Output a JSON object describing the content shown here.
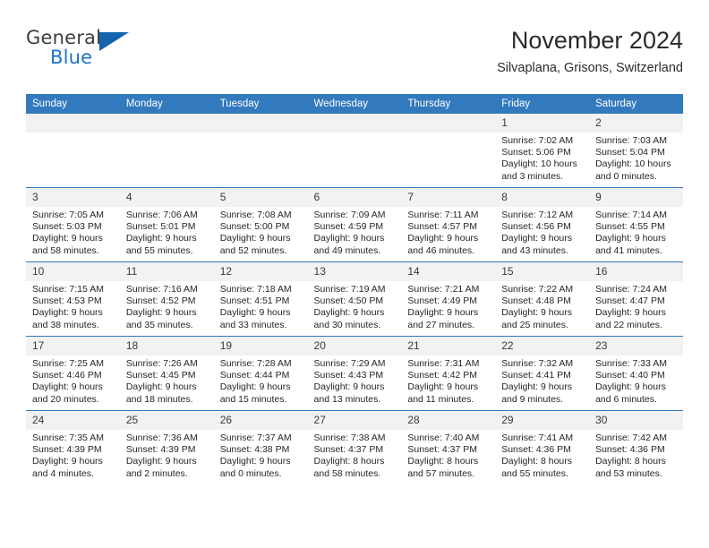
{
  "brand": {
    "name_part1": "General",
    "name_part2": "Blue",
    "accent_color": "#1565ae"
  },
  "header": {
    "title": "November 2024",
    "subtitle": "Silvaplana, Grisons, Switzerland"
  },
  "calendar": {
    "header_background": "#3379bd",
    "daynum_background": "#f2f2f2",
    "weekday_headers": [
      "Sunday",
      "Monday",
      "Tuesday",
      "Wednesday",
      "Thursday",
      "Friday",
      "Saturday"
    ],
    "weeks": [
      [
        {
          "day": "",
          "empty": true
        },
        {
          "day": "",
          "empty": true
        },
        {
          "day": "",
          "empty": true
        },
        {
          "day": "",
          "empty": true
        },
        {
          "day": "",
          "empty": true
        },
        {
          "day": "1",
          "sunrise": "Sunrise: 7:02 AM",
          "sunset": "Sunset: 5:06 PM",
          "daylight": "Daylight: 10 hours and 3 minutes."
        },
        {
          "day": "2",
          "sunrise": "Sunrise: 7:03 AM",
          "sunset": "Sunset: 5:04 PM",
          "daylight": "Daylight: 10 hours and 0 minutes."
        }
      ],
      [
        {
          "day": "3",
          "sunrise": "Sunrise: 7:05 AM",
          "sunset": "Sunset: 5:03 PM",
          "daylight": "Daylight: 9 hours and 58 minutes."
        },
        {
          "day": "4",
          "sunrise": "Sunrise: 7:06 AM",
          "sunset": "Sunset: 5:01 PM",
          "daylight": "Daylight: 9 hours and 55 minutes."
        },
        {
          "day": "5",
          "sunrise": "Sunrise: 7:08 AM",
          "sunset": "Sunset: 5:00 PM",
          "daylight": "Daylight: 9 hours and 52 minutes."
        },
        {
          "day": "6",
          "sunrise": "Sunrise: 7:09 AM",
          "sunset": "Sunset: 4:59 PM",
          "daylight": "Daylight: 9 hours and 49 minutes."
        },
        {
          "day": "7",
          "sunrise": "Sunrise: 7:11 AM",
          "sunset": "Sunset: 4:57 PM",
          "daylight": "Daylight: 9 hours and 46 minutes."
        },
        {
          "day": "8",
          "sunrise": "Sunrise: 7:12 AM",
          "sunset": "Sunset: 4:56 PM",
          "daylight": "Daylight: 9 hours and 43 minutes."
        },
        {
          "day": "9",
          "sunrise": "Sunrise: 7:14 AM",
          "sunset": "Sunset: 4:55 PM",
          "daylight": "Daylight: 9 hours and 41 minutes."
        }
      ],
      [
        {
          "day": "10",
          "sunrise": "Sunrise: 7:15 AM",
          "sunset": "Sunset: 4:53 PM",
          "daylight": "Daylight: 9 hours and 38 minutes."
        },
        {
          "day": "11",
          "sunrise": "Sunrise: 7:16 AM",
          "sunset": "Sunset: 4:52 PM",
          "daylight": "Daylight: 9 hours and 35 minutes."
        },
        {
          "day": "12",
          "sunrise": "Sunrise: 7:18 AM",
          "sunset": "Sunset: 4:51 PM",
          "daylight": "Daylight: 9 hours and 33 minutes."
        },
        {
          "day": "13",
          "sunrise": "Sunrise: 7:19 AM",
          "sunset": "Sunset: 4:50 PM",
          "daylight": "Daylight: 9 hours and 30 minutes."
        },
        {
          "day": "14",
          "sunrise": "Sunrise: 7:21 AM",
          "sunset": "Sunset: 4:49 PM",
          "daylight": "Daylight: 9 hours and 27 minutes."
        },
        {
          "day": "15",
          "sunrise": "Sunrise: 7:22 AM",
          "sunset": "Sunset: 4:48 PM",
          "daylight": "Daylight: 9 hours and 25 minutes."
        },
        {
          "day": "16",
          "sunrise": "Sunrise: 7:24 AM",
          "sunset": "Sunset: 4:47 PM",
          "daylight": "Daylight: 9 hours and 22 minutes."
        }
      ],
      [
        {
          "day": "17",
          "sunrise": "Sunrise: 7:25 AM",
          "sunset": "Sunset: 4:46 PM",
          "daylight": "Daylight: 9 hours and 20 minutes."
        },
        {
          "day": "18",
          "sunrise": "Sunrise: 7:26 AM",
          "sunset": "Sunset: 4:45 PM",
          "daylight": "Daylight: 9 hours and 18 minutes."
        },
        {
          "day": "19",
          "sunrise": "Sunrise: 7:28 AM",
          "sunset": "Sunset: 4:44 PM",
          "daylight": "Daylight: 9 hours and 15 minutes."
        },
        {
          "day": "20",
          "sunrise": "Sunrise: 7:29 AM",
          "sunset": "Sunset: 4:43 PM",
          "daylight": "Daylight: 9 hours and 13 minutes."
        },
        {
          "day": "21",
          "sunrise": "Sunrise: 7:31 AM",
          "sunset": "Sunset: 4:42 PM",
          "daylight": "Daylight: 9 hours and 11 minutes."
        },
        {
          "day": "22",
          "sunrise": "Sunrise: 7:32 AM",
          "sunset": "Sunset: 4:41 PM",
          "daylight": "Daylight: 9 hours and 9 minutes."
        },
        {
          "day": "23",
          "sunrise": "Sunrise: 7:33 AM",
          "sunset": "Sunset: 4:40 PM",
          "daylight": "Daylight: 9 hours and 6 minutes."
        }
      ],
      [
        {
          "day": "24",
          "sunrise": "Sunrise: 7:35 AM",
          "sunset": "Sunset: 4:39 PM",
          "daylight": "Daylight: 9 hours and 4 minutes."
        },
        {
          "day": "25",
          "sunrise": "Sunrise: 7:36 AM",
          "sunset": "Sunset: 4:39 PM",
          "daylight": "Daylight: 9 hours and 2 minutes."
        },
        {
          "day": "26",
          "sunrise": "Sunrise: 7:37 AM",
          "sunset": "Sunset: 4:38 PM",
          "daylight": "Daylight: 9 hours and 0 minutes."
        },
        {
          "day": "27",
          "sunrise": "Sunrise: 7:38 AM",
          "sunset": "Sunset: 4:37 PM",
          "daylight": "Daylight: 8 hours and 58 minutes."
        },
        {
          "day": "28",
          "sunrise": "Sunrise: 7:40 AM",
          "sunset": "Sunset: 4:37 PM",
          "daylight": "Daylight: 8 hours and 57 minutes."
        },
        {
          "day": "29",
          "sunrise": "Sunrise: 7:41 AM",
          "sunset": "Sunset: 4:36 PM",
          "daylight": "Daylight: 8 hours and 55 minutes."
        },
        {
          "day": "30",
          "sunrise": "Sunrise: 7:42 AM",
          "sunset": "Sunset: 4:36 PM",
          "daylight": "Daylight: 8 hours and 53 minutes."
        }
      ]
    ]
  }
}
